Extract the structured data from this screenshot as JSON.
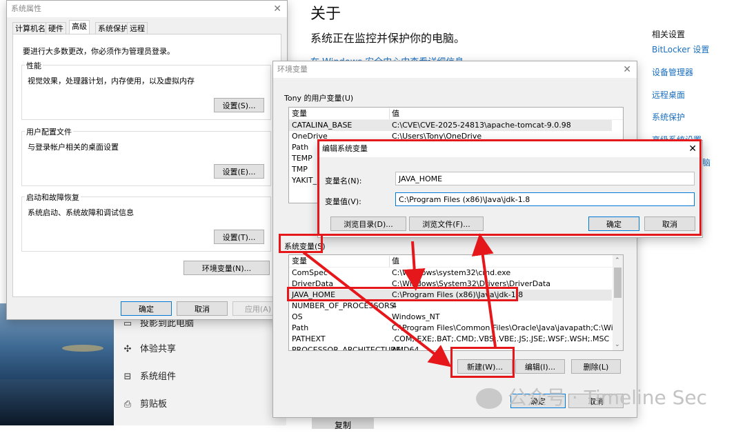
{
  "settings": {
    "title": "关于",
    "subtitle": "系统正在监控并保护你的电脑。",
    "link": "在 Windows 安全中心中查看详细信息",
    "related_heading": "相关设置",
    "related_links": [
      "BitLocker 设置",
      "设备管理器",
      "远程桌面",
      "系统保护",
      "高级系统设置",
      "重命名这台电脑"
    ],
    "nav": [
      {
        "icon": "clipboard-icon",
        "label": "投影到此电脑"
      },
      {
        "icon": "share-icon",
        "label": "体验共享"
      },
      {
        "icon": "components-icon",
        "label": "系统组件"
      },
      {
        "icon": "clipboard-icon",
        "label": "剪贴板"
      }
    ],
    "copy_button": "复制"
  },
  "sysprops": {
    "title": "系统属性",
    "tabs": [
      "计算机名",
      "硬件",
      "高级",
      "系统保护",
      "远程"
    ],
    "active_tab": 2,
    "admin_note": "要进行大多数更改，你必须作为管理员登录。",
    "performance": {
      "label": "性能",
      "desc": "视觉效果，处理器计划，内存使用，以及虚拟内存",
      "button": "设置(S)..."
    },
    "profile": {
      "label": "用户配置文件",
      "desc": "与登录帐户相关的桌面设置",
      "button": "设置(E)..."
    },
    "startup": {
      "label": "启动和故障恢复",
      "desc": "系统启动、系统故障和调试信息",
      "button": "设置(T)..."
    },
    "env_button": "环境变量(N)...",
    "ok": "确定",
    "cancel": "取消",
    "apply": "应用(A)"
  },
  "envvars": {
    "title": "环境变量",
    "user_group": "Tony 的用户变量(U)",
    "col_name": "变量",
    "col_value": "值",
    "user_rows": [
      {
        "name": "CATALINA_BASE",
        "value": "C:\\CVE\\CVE-2025-24813\\apache-tomcat-9.0.98"
      },
      {
        "name": "OneDrive",
        "value": "C:\\Users\\Tony\\OneDrive"
      },
      {
        "name": "Path",
        "value": ""
      },
      {
        "name": "TEMP",
        "value": ""
      },
      {
        "name": "TMP",
        "value": ""
      },
      {
        "name": "YAKIT_H",
        "value": ""
      }
    ],
    "system_group": "系统变量(S)",
    "system_rows": [
      {
        "name": "ComSpec",
        "value": "C:\\Windows\\system32\\cmd.exe"
      },
      {
        "name": "DriverData",
        "value": "C:\\Windows\\System32\\Drivers\\DriverData"
      },
      {
        "name": "JAVA_HOME",
        "value": "C:\\Program Files (x86)\\Java\\jdk-1.8"
      },
      {
        "name": "NUMBER_OF_PROCESSORS",
        "value": "4"
      },
      {
        "name": "OS",
        "value": "Windows_NT"
      },
      {
        "name": "Path",
        "value": "C:\\Program Files\\Common Files\\Oracle\\Java\\javapath;C:\\Windo..."
      },
      {
        "name": "PATHEXT",
        "value": ".COM;.EXE;.BAT;.CMD;.VBS;.VBE;.JS;.JSE;.WSF;.WSH;.MSC"
      },
      {
        "name": "PROCESSOR_ARCHITECTURE",
        "value": "AMD64"
      }
    ],
    "new_button": "新建(W)...",
    "edit_button": "编辑(I)...",
    "delete_button": "删除(L)",
    "ok": "确定",
    "cancel": "取消"
  },
  "editvar": {
    "title": "编辑系统变量",
    "name_label": "变量名(N):",
    "name_value": "JAVA_HOME",
    "value_label": "变量值(V):",
    "value_value": "C:\\Program Files (x86)\\Java\\jdk-1.8",
    "browse_dir": "浏览目录(D)...",
    "browse_file": "浏览文件(F)...",
    "ok": "确定",
    "cancel": "取消"
  },
  "watermark": "公众号 · Timeline Sec",
  "colors": {
    "annotation_red": "#e5171b",
    "link_blue": "#1a6fbf"
  }
}
